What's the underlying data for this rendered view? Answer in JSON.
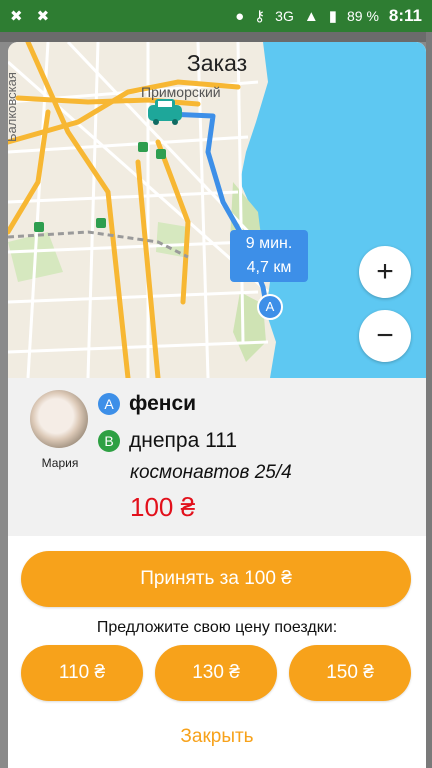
{
  "statusbar": {
    "network": "3G",
    "battery": "89 %",
    "time": "8:11"
  },
  "header": {
    "title": "Заказ"
  },
  "map": {
    "district_label": "Приморский",
    "edge_label": "Балковская",
    "route_eta": "9 мин.",
    "route_distance": "4,7 км",
    "marker_a": "A",
    "zoom_in_label": "+",
    "zoom_out_label": "−"
  },
  "order": {
    "passenger_name": "Мария",
    "point_a_badge": "A",
    "point_a": "фенси",
    "point_b_badge": "B",
    "point_b": "днепра 111",
    "stop": "космонавтов 25/4",
    "price": "100 ₴"
  },
  "actions": {
    "accept_label": "Принять за 100 ₴",
    "offer_prompt": "Предложите свою цену поездки:",
    "offers": [
      "110 ₴",
      "130 ₴",
      "150 ₴"
    ],
    "close_label": "Закрыть"
  }
}
